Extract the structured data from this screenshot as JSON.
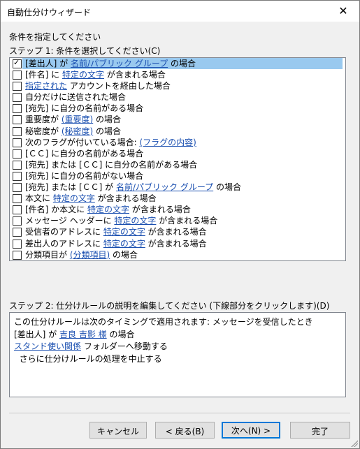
{
  "window": {
    "title": "自動仕分けウィザード",
    "close_glyph": "✕"
  },
  "instructions": "条件を指定してください",
  "step1": {
    "label": "ステップ 1: 条件を選択してください(C)",
    "items": [
      {
        "checked": true,
        "selected": true,
        "parts": [
          {
            "t": "[差出人] が "
          },
          {
            "t": "名前/パブリック グループ",
            "link": true
          },
          {
            "t": " の場合"
          }
        ]
      },
      {
        "checked": false,
        "parts": [
          {
            "t": "[件名] に "
          },
          {
            "t": "特定の文字",
            "link": true
          },
          {
            "t": " が含まれる場合"
          }
        ]
      },
      {
        "checked": false,
        "parts": [
          {
            "t": "指定された",
            "link": true
          },
          {
            "t": " アカウントを経由した場合"
          }
        ]
      },
      {
        "checked": false,
        "parts": [
          {
            "t": "自分だけに送信された場合"
          }
        ]
      },
      {
        "checked": false,
        "parts": [
          {
            "t": "[宛先] に自分の名前がある場合"
          }
        ]
      },
      {
        "checked": false,
        "parts": [
          {
            "t": "重要度が "
          },
          {
            "t": "(重要度)",
            "link": true
          },
          {
            "t": " の場合"
          }
        ]
      },
      {
        "checked": false,
        "parts": [
          {
            "t": "秘密度が "
          },
          {
            "t": "(秘密度)",
            "link": true
          },
          {
            "t": " の場合"
          }
        ]
      },
      {
        "checked": false,
        "parts": [
          {
            "t": "次のフラグが付いている場合: "
          },
          {
            "t": "(フラグの内容)",
            "link": true
          }
        ]
      },
      {
        "checked": false,
        "parts": [
          {
            "t": "[ＣＣ] に自分の名前がある場合"
          }
        ]
      },
      {
        "checked": false,
        "parts": [
          {
            "t": "[宛先] または [ＣＣ] に自分の名前がある場合"
          }
        ]
      },
      {
        "checked": false,
        "parts": [
          {
            "t": "[宛先] に自分の名前がない場合"
          }
        ]
      },
      {
        "checked": false,
        "parts": [
          {
            "t": "[宛先] または [ＣＣ] が "
          },
          {
            "t": "名前/パブリック グループ",
            "link": true
          },
          {
            "t": " の場合"
          }
        ]
      },
      {
        "checked": false,
        "parts": [
          {
            "t": "本文に "
          },
          {
            "t": "特定の文字",
            "link": true
          },
          {
            "t": " が含まれる場合"
          }
        ]
      },
      {
        "checked": false,
        "parts": [
          {
            "t": "[件名] か本文に "
          },
          {
            "t": "特定の文字",
            "link": true
          },
          {
            "t": " が含まれる場合"
          }
        ]
      },
      {
        "checked": false,
        "parts": [
          {
            "t": "メッセージ ヘッダーに "
          },
          {
            "t": "特定の文字",
            "link": true
          },
          {
            "t": " が含まれる場合"
          }
        ]
      },
      {
        "checked": false,
        "parts": [
          {
            "t": "受信者のアドレスに "
          },
          {
            "t": "特定の文字",
            "link": true
          },
          {
            "t": " が含まれる場合"
          }
        ]
      },
      {
        "checked": false,
        "parts": [
          {
            "t": "差出人のアドレスに "
          },
          {
            "t": "特定の文字",
            "link": true
          },
          {
            "t": " が含まれる場合"
          }
        ]
      },
      {
        "checked": false,
        "parts": [
          {
            "t": "分類項目が "
          },
          {
            "t": "(分類項目)",
            "link": true
          },
          {
            "t": " の場合"
          }
        ]
      }
    ]
  },
  "step2": {
    "label": "ステップ 2: 仕分けルールの説明を編集してください (下線部分をクリックします)(D)",
    "lines": [
      {
        "parts": [
          {
            "t": "この仕分けルールは次のタイミングで適用されます: メッセージを受信したとき"
          }
        ]
      },
      {
        "parts": [
          {
            "t": "[差出人] が "
          },
          {
            "t": "吉良 吉影 様",
            "link": true
          },
          {
            "t": " の場合"
          }
        ]
      },
      {
        "parts": [
          {
            "t": "スタンド使い関係",
            "link": true
          },
          {
            "t": " フォルダーへ移動する"
          }
        ]
      },
      {
        "parts": [
          {
            "t": "  さらに仕分けルールの処理を中止する"
          }
        ]
      }
    ]
  },
  "buttons": {
    "cancel": "キャンセル",
    "back": "< 戻る(B)",
    "next": "次へ(N) >",
    "finish": "完了"
  }
}
